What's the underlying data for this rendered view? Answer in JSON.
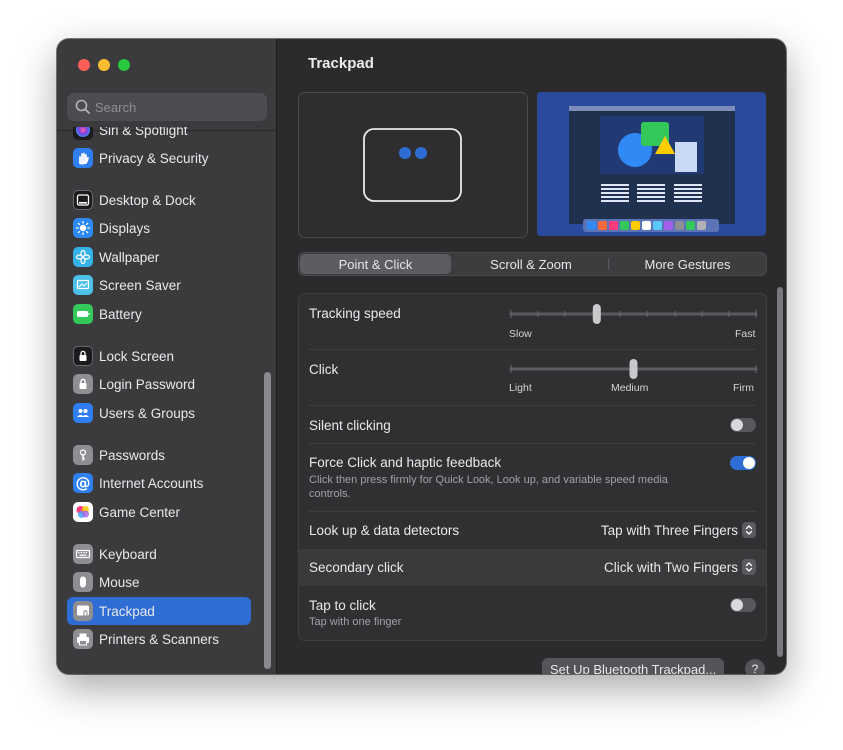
{
  "window": {
    "title": "Trackpad"
  },
  "search": {
    "placeholder": "Search"
  },
  "sidebar": {
    "items": [
      {
        "label": "Siri & Spotlight",
        "icon": "siri-icon"
      },
      {
        "label": "Privacy & Security",
        "icon": "hand-icon"
      },
      {
        "label": "Desktop & Dock",
        "icon": "dock-icon"
      },
      {
        "label": "Displays",
        "icon": "sun-icon"
      },
      {
        "label": "Wallpaper",
        "icon": "flower-icon"
      },
      {
        "label": "Screen Saver",
        "icon": "screen-saver-icon"
      },
      {
        "label": "Battery",
        "icon": "battery-icon"
      },
      {
        "label": "Lock Screen",
        "icon": "lock-icon"
      },
      {
        "label": "Login Password",
        "icon": "lock-icon"
      },
      {
        "label": "Users & Groups",
        "icon": "users-icon"
      },
      {
        "label": "Passwords",
        "icon": "key-icon"
      },
      {
        "label": "Internet Accounts",
        "icon": "at-icon"
      },
      {
        "label": "Game Center",
        "icon": "game-center-icon"
      },
      {
        "label": "Keyboard",
        "icon": "keyboard-icon"
      },
      {
        "label": "Mouse",
        "icon": "mouse-icon"
      },
      {
        "label": "Trackpad",
        "icon": "trackpad-icon",
        "selected": true
      },
      {
        "label": "Printers & Scanners",
        "icon": "printer-icon"
      }
    ]
  },
  "tabs": [
    {
      "label": "Point & Click",
      "active": true
    },
    {
      "label": "Scroll & Zoom",
      "active": false
    },
    {
      "label": "More Gestures",
      "active": false
    }
  ],
  "settings": {
    "tracking_speed": {
      "label": "Tracking speed",
      "min_label": "Slow",
      "max_label": "Fast",
      "value": 0.35
    },
    "click": {
      "label": "Click",
      "labels": [
        "Light",
        "Medium",
        "Firm"
      ],
      "value": 0.5
    },
    "silent_clicking": {
      "label": "Silent clicking",
      "on": false
    },
    "force_click": {
      "label": "Force Click and haptic feedback",
      "description": "Click then press firmly for Quick Look, Look up, and variable speed media controls.",
      "on": true
    },
    "look_up": {
      "label": "Look up & data detectors",
      "value": "Tap with Three Fingers"
    },
    "secondary_click": {
      "label": "Secondary click",
      "value": "Click with Two Fingers"
    },
    "tap_to_click": {
      "label": "Tap to click",
      "description": "Tap with one finger",
      "on": false
    }
  },
  "buttons": {
    "bluetooth": "Set Up Bluetooth Trackpad...",
    "help": "?"
  },
  "colors": {
    "accent": "#2e6ed4"
  }
}
